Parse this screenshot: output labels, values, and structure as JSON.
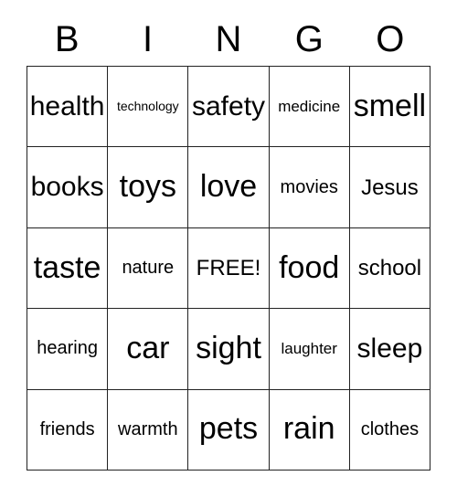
{
  "card": {
    "header": {
      "letters": [
        "B",
        "I",
        "N",
        "G",
        "O"
      ]
    },
    "grid": {
      "columns": 5,
      "rows": 5,
      "free_space_label": "FREE!",
      "free_space_position": "center",
      "cells": [
        [
          {
            "text": "health",
            "size": "fs-xl"
          },
          {
            "text": "technology",
            "size": "fs-xs"
          },
          {
            "text": "safety",
            "size": "fs-xl"
          },
          {
            "text": "medicine",
            "size": "fs-s"
          },
          {
            "text": "smell",
            "size": "fs-xxl"
          }
        ],
        [
          {
            "text": "books",
            "size": "fs-xl"
          },
          {
            "text": "toys",
            "size": "fs-xxl"
          },
          {
            "text": "love",
            "size": "fs-xxl"
          },
          {
            "text": "movies",
            "size": "fs-m"
          },
          {
            "text": "Jesus",
            "size": "fs-l"
          }
        ],
        [
          {
            "text": "taste",
            "size": "fs-xxl"
          },
          {
            "text": "nature",
            "size": "fs-m"
          },
          {
            "text": "FREE!",
            "size": "fs-l"
          },
          {
            "text": "food",
            "size": "fs-xxl"
          },
          {
            "text": "school",
            "size": "fs-l"
          }
        ],
        [
          {
            "text": "hearing",
            "size": "fs-m"
          },
          {
            "text": "car",
            "size": "fs-xxl"
          },
          {
            "text": "sight",
            "size": "fs-xxl"
          },
          {
            "text": "laughter",
            "size": "fs-s"
          },
          {
            "text": "sleep",
            "size": "fs-xl"
          }
        ],
        [
          {
            "text": "friends",
            "size": "fs-m"
          },
          {
            "text": "warmth",
            "size": "fs-m"
          },
          {
            "text": "pets",
            "size": "fs-xxl"
          },
          {
            "text": "rain",
            "size": "fs-xxl"
          },
          {
            "text": "clothes",
            "size": "fs-m"
          }
        ]
      ]
    },
    "colors": {
      "background": "#ffffff",
      "text": "#000000",
      "grid_line": "#222222"
    }
  }
}
